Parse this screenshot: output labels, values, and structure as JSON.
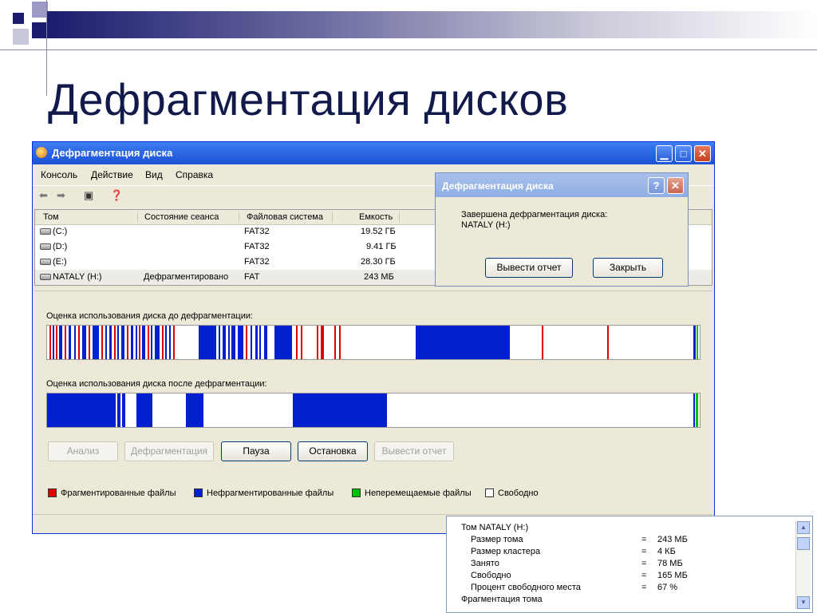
{
  "slide": {
    "title": "Дефрагментация дисков"
  },
  "window": {
    "title": "Дефрагментация диска",
    "menu": [
      "Консоль",
      "Действие",
      "Вид",
      "Справка"
    ],
    "columns": [
      "Том",
      "Состояние сеанса",
      "Файловая система",
      "Емкость"
    ],
    "volumes": [
      {
        "name": "(C:)",
        "status": "",
        "fs": "FAT32",
        "capacity": "19.52 ГБ"
      },
      {
        "name": "(D:)",
        "status": "",
        "fs": "FAT32",
        "capacity": "9.41 ГБ"
      },
      {
        "name": "(E:)",
        "status": "",
        "fs": "FAT32",
        "capacity": "28.30 ГБ"
      },
      {
        "name": "NATALY (H:)",
        "status": "Дефрагментировано",
        "fs": "FAT",
        "capacity": "243 МБ"
      }
    ],
    "before_label": "Оценка использования диска до дефрагментации:",
    "after_label": "Оценка использования диска после дефрагментации:",
    "buttons": {
      "analyze": "Анализ",
      "defrag": "Дефрагментация",
      "pause": "Пауза",
      "stop": "Остановка",
      "report": "Вывести отчет"
    },
    "legend": {
      "fragmented": "Фрагментированные файлы",
      "contiguous": "Нефрагментированные файлы",
      "unmovable": "Неперемещаемые файлы",
      "free": "Свободно"
    },
    "colors": {
      "fragmented": "#e00000",
      "contiguous": "#0020d0",
      "unmovable": "#00c000",
      "free": "#ffffff"
    }
  },
  "dialog": {
    "title": "Дефрагментация диска",
    "message_line1": "Завершена дефрагментация диска:",
    "message_line2": "NATALY (H:)",
    "report_button": "Вывести отчет",
    "close_button": "Закрыть"
  },
  "details": {
    "volume_label": "Том NATALY (H:)",
    "rows": [
      {
        "key": "Размер тома",
        "eq": "=",
        "value": "243 МБ"
      },
      {
        "key": "Размер кластера",
        "eq": "=",
        "value": "4 КБ"
      },
      {
        "key": "Занято",
        "eq": "=",
        "value": "78 МБ"
      },
      {
        "key": "Свободно",
        "eq": "=",
        "value": "165 МБ"
      },
      {
        "key": "Процент свободного места",
        "eq": "=",
        "value": "67 %"
      }
    ],
    "fragmentation_label": "Фрагментация тома"
  }
}
